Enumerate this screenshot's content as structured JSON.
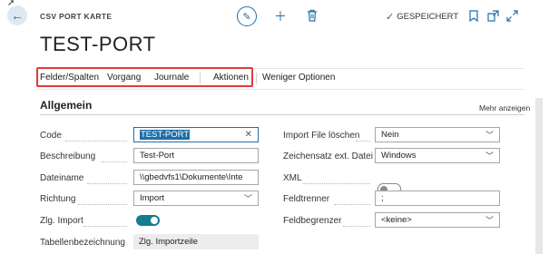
{
  "header": {
    "caption": "CSV PORT KARTE",
    "title": "TEST-PORT",
    "save_status": "GESPEICHERT"
  },
  "actions": {
    "items": [
      "Felder/Spalten",
      "Vorgang",
      "Journale",
      "Aktionen",
      "Weniger Optionen"
    ]
  },
  "section": {
    "title": "Allgemein",
    "show_more": "Mehr anzeigen"
  },
  "left_fields": {
    "code": {
      "label": "Code",
      "value": "TEST-PORT"
    },
    "beschreibung": {
      "label": "Beschreibung",
      "value": "Test-Port"
    },
    "dateiname": {
      "label": "Dateiname",
      "value": "\\\\gbedvfs1\\Dokumente\\Inte"
    },
    "richtung": {
      "label": "Richtung",
      "value": "Import"
    },
    "zlg_import": {
      "label": "Zlg. Import",
      "value": true
    },
    "tabellenbezeichnung": {
      "label": "Tabellenbezeichnung",
      "value": "Zlg. Importzeile"
    }
  },
  "right_fields": {
    "import_file_loeschen": {
      "label": "Import File löschen",
      "value": "Nein"
    },
    "zeichensatz": {
      "label": "Zeichensatz ext. Datei",
      "value": "Windows"
    },
    "xml": {
      "label": "XML",
      "value": false
    },
    "feldtrenner": {
      "label": "Feldtrenner",
      "value": ";"
    },
    "feldbegrenzer": {
      "label": "Feldbegrenzer",
      "value": "<keine>"
    }
  },
  "icons": {
    "back": "arrow-left-icon",
    "edit": "pencil-icon",
    "add": "plus-icon",
    "delete": "trash-icon",
    "saved": "checkmark-icon",
    "bookmark": "bookmark-icon",
    "open_new": "open-in-new-window-icon",
    "expand": "expand-icon"
  },
  "colors": {
    "accent": "#1f6fa8",
    "toggle_on": "#157b8f",
    "highlight": "#e03a3a"
  }
}
